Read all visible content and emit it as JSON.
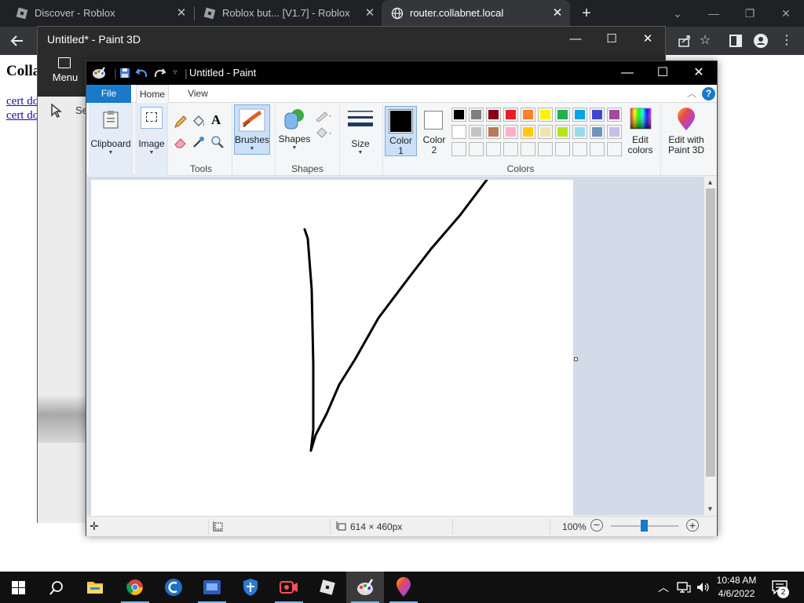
{
  "browser": {
    "tabs": [
      {
        "title": "Discover - Roblox",
        "active": false,
        "icon": "roblox-icon"
      },
      {
        "title": "Roblox but... [V1.7] - Roblox",
        "active": false,
        "icon": "roblox-icon"
      },
      {
        "title": "router.collabnet.local",
        "active": true,
        "icon": "globe-icon"
      }
    ],
    "new_tab": "+"
  },
  "webpage": {
    "heading": "Colla",
    "links": [
      "cert do",
      "cert do"
    ]
  },
  "paint3d": {
    "title": "Untitled* - Paint 3D",
    "menu_label": "Menu",
    "select_label": "Se"
  },
  "paint": {
    "title": "Untitled - Paint",
    "tabs": {
      "file": "File",
      "home": "Home",
      "view": "View"
    },
    "ribbon": {
      "clipboard": "Clipboard",
      "image": "Image",
      "tools": "Tools",
      "brushes": "Brushes",
      "shapes_btn": "Shapes",
      "shapes_group": "Shapes",
      "size": "Size",
      "color1_a": "Color",
      "color1_b": "1",
      "color2_a": "Color",
      "color2_b": "2",
      "colors_group": "Colors",
      "edit_colors_a": "Edit",
      "edit_colors_b": "colors",
      "edit_p3d_a": "Edit with",
      "edit_p3d_b": "Paint 3D"
    },
    "palette_row1": [
      "#000000",
      "#7f7f7f",
      "#880015",
      "#ed1c24",
      "#ff7f27",
      "#fff200",
      "#22b14c",
      "#00a2e8",
      "#3f48cc",
      "#a349a4"
    ],
    "palette_row2": [
      "#ffffff",
      "#c3c3c3",
      "#b97a57",
      "#ffaec9",
      "#ffc90e",
      "#efe4b0",
      "#b5e61d",
      "#99d9ea",
      "#7092be",
      "#c8bfe7"
    ],
    "color1": "#000000",
    "color2": "#ffffff",
    "status": {
      "canvas_size": "614 × 460px",
      "zoom": "100%"
    }
  },
  "taskbar": {
    "time": "10:48 AM",
    "date": "4/6/2022",
    "notifications": "2",
    "apps": [
      "windows-start",
      "search",
      "file-explorer",
      "chrome",
      "ccleaner",
      "remote-desktop",
      "security-shield",
      "screen-recorder",
      "roblox",
      "paint",
      "paint-3d"
    ]
  }
}
